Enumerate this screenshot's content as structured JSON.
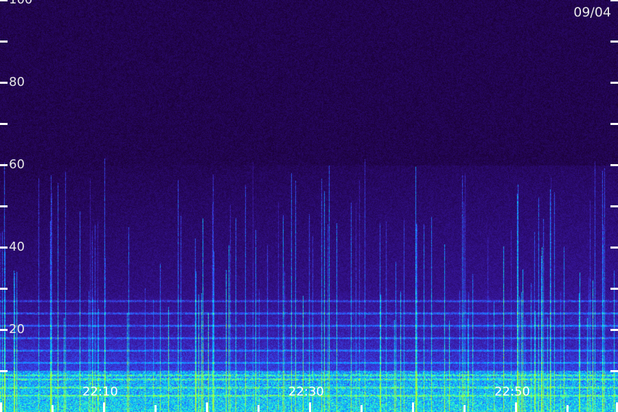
{
  "chart_data": {
    "type": "heatmap",
    "title": "",
    "date_label": "09/04",
    "xlabel": "",
    "ylabel": "",
    "x_tick_labels": [
      "22:10",
      "22:30",
      "22:50"
    ],
    "y_ticks": [
      10,
      20,
      30,
      40,
      50,
      60,
      70,
      80,
      90,
      100
    ],
    "y_tick_labels": [
      "20",
      "40",
      "60",
      "80",
      "100"
    ],
    "ylim": [
      0,
      100
    ],
    "colormap": [
      "#1a0033",
      "#2a0a6e",
      "#3a1aa8",
      "#3355ff",
      "#00bbff",
      "#33ffcc",
      "#aaff33"
    ],
    "grid": false
  }
}
